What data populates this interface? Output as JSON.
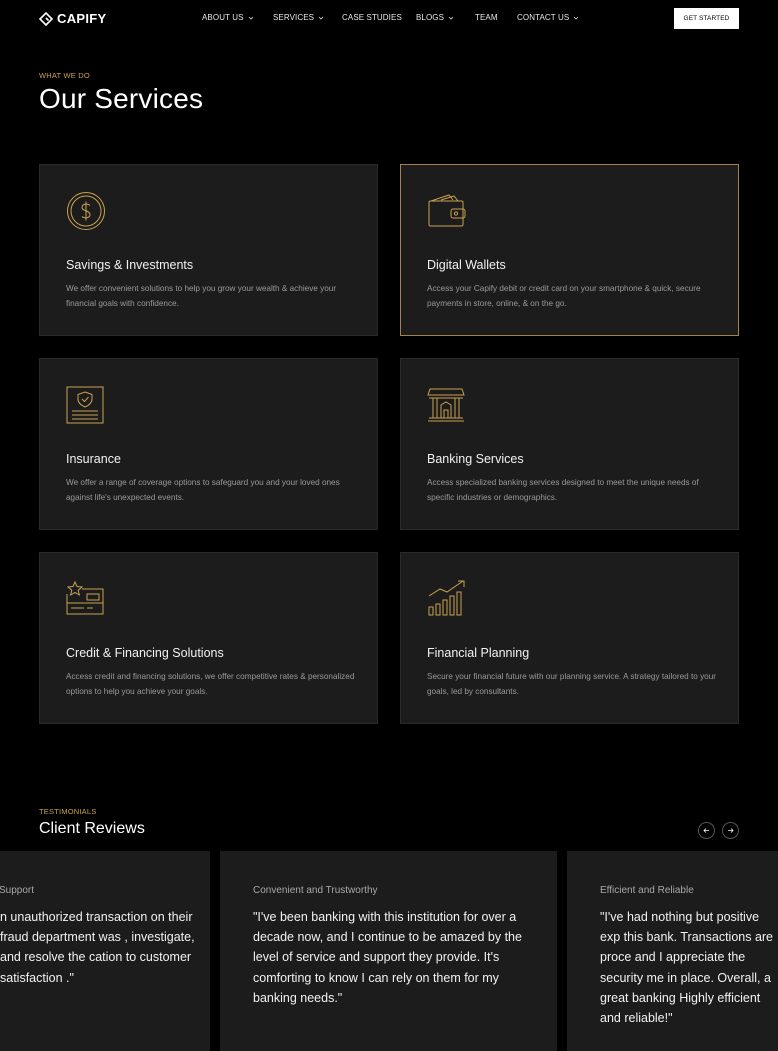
{
  "nav": {
    "brand": "CAPIFY",
    "items": [
      {
        "label": "ABOUT US",
        "dropdown": true
      },
      {
        "label": "SERVICES",
        "dropdown": true
      },
      {
        "label": "CASE STUDIES",
        "dropdown": false
      },
      {
        "label": "BLOGS",
        "dropdown": true
      },
      {
        "label": "TEAM",
        "dropdown": false
      },
      {
        "label": "CONTACT US",
        "dropdown": true
      }
    ],
    "cta": "GET STARTED"
  },
  "services": {
    "eyebrow": "WHAT WE DO",
    "title": "Our Services",
    "cards": [
      {
        "icon": "dollar-coin-icon",
        "title": "Savings & Investments",
        "desc": "We offer convenient solutions to help you grow your wealth & achieve your financial goals with confidence."
      },
      {
        "icon": "wallet-icon",
        "title": "Digital Wallets",
        "desc": "Access your Capify debit or credit card on your smartphone & quick, secure payments in store, online, & on the go."
      },
      {
        "icon": "insurance-document-icon",
        "title": "Insurance",
        "desc": "We offer a range of coverage options to safeguard you and your loved ones against life's unexpected events."
      },
      {
        "icon": "bank-building-icon",
        "title": "Banking Services",
        "desc": "Access specialized banking services designed to meet the unique needs of specific industries or demographics."
      },
      {
        "icon": "credit-card-star-icon",
        "title": "Credit & Financing Solutions",
        "desc": "Access credit and financing solutions, we offer competitive rates & personalized options to help you achieve your goals."
      },
      {
        "icon": "growth-chart-icon",
        "title": "Financial Planning",
        "desc": "Secure your financial future with our planning service. A strategy tailored to your goals, led by consultants."
      }
    ]
  },
  "testimonials": {
    "eyebrow": "TESTIMONIALS",
    "title": "Client Reviews",
    "reviews": [
      {
        "title": "Support",
        "text": "n unauthorized transaction on their fraud department was , investigate, and resolve the cation to customer satisfaction .\""
      },
      {
        "title": "Convenient and Trustworthy",
        "text": "\"I've been banking with this institution for over a decade now, and I continue to be amazed by the level of service and support they provide. It's comforting to know I can rely on them for my banking needs.\""
      },
      {
        "title": "Efficient and Reliable",
        "text": "\"I've had nothing but positive exp this bank. Transactions are proce and I appreciate the security me in place. Overall, a great banking Highly efficient and reliable!\""
      }
    ]
  },
  "colors": {
    "accent": "#c9a24f",
    "card_bg": "#1c1c1c",
    "active_border": "#9f8350"
  }
}
